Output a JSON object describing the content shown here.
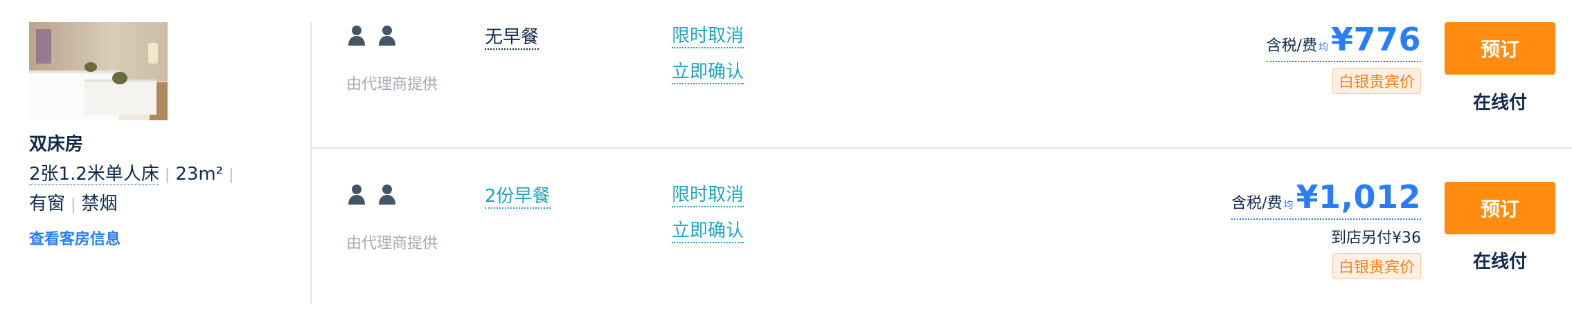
{
  "room": {
    "name": "双床房",
    "bed": "2张1.2米单人床",
    "area": "23m²",
    "window": "有窗",
    "smoking": "禁烟",
    "link": "查看客房信息"
  },
  "rates": [
    {
      "guests": 2,
      "provider": "由代理商提供",
      "meal": "无早餐",
      "policy_cancel": "限时取消",
      "policy_confirm": "立即确认",
      "tax_label": "含税/费",
      "avg_label": "均",
      "price": "¥776",
      "extra_fee": "",
      "badge": "白银贵宾价",
      "book_label": "预订",
      "pay_label": "在线付"
    },
    {
      "guests": 2,
      "provider": "由代理商提供",
      "meal": "2份早餐",
      "policy_cancel": "限时取消",
      "policy_confirm": "立即确认",
      "tax_label": "含税/费",
      "avg_label": "均",
      "price": "¥1,012",
      "extra_fee": "到店另付¥36",
      "badge": "白银贵宾价",
      "book_label": "预订",
      "pay_label": "在线付"
    }
  ],
  "colors": {
    "accent_blue": "#287dfa",
    "teal": "#1ba6c2",
    "orange": "#ff8c0e",
    "text_dark": "#0f294d"
  }
}
